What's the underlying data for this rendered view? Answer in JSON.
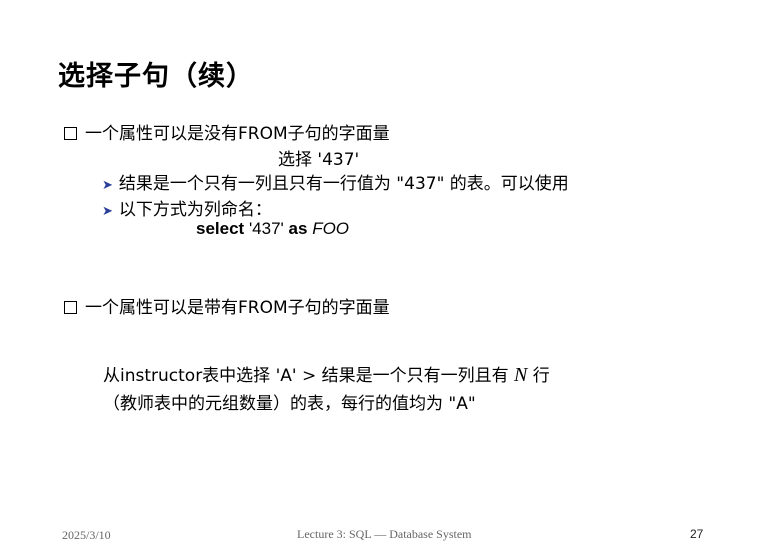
{
  "slide": {
    "title": "选择子句（续）",
    "item1": {
      "text": "一个属性可以是没有FROM子句的字面量",
      "center_line": "选择 '437'",
      "sub1": "结果是一个只有一列且只有一行值为 \"437\" 的表。可以使用",
      "sub2": "以下方式为列命名：",
      "code": {
        "kw_select": "select",
        "literal": "'437'",
        "kw_as": "as",
        "alias": "FOO"
      }
    },
    "item2": {
      "text": "一个属性可以是带有FROM子句的字面量",
      "line1_prefix": "从instructor表中选择 'A'",
      "line1_op": ">",
      "line1_mid": "结果是一个只有一列且有",
      "line1_var": "N",
      "line1_suffix": "行",
      "line2": "（教师表中的元组数量）的表，每行的值均为 \"A\""
    },
    "footer": {
      "date": "2025/3/10",
      "center": "Lecture 3: SQL — Database System",
      "page": "27"
    }
  }
}
